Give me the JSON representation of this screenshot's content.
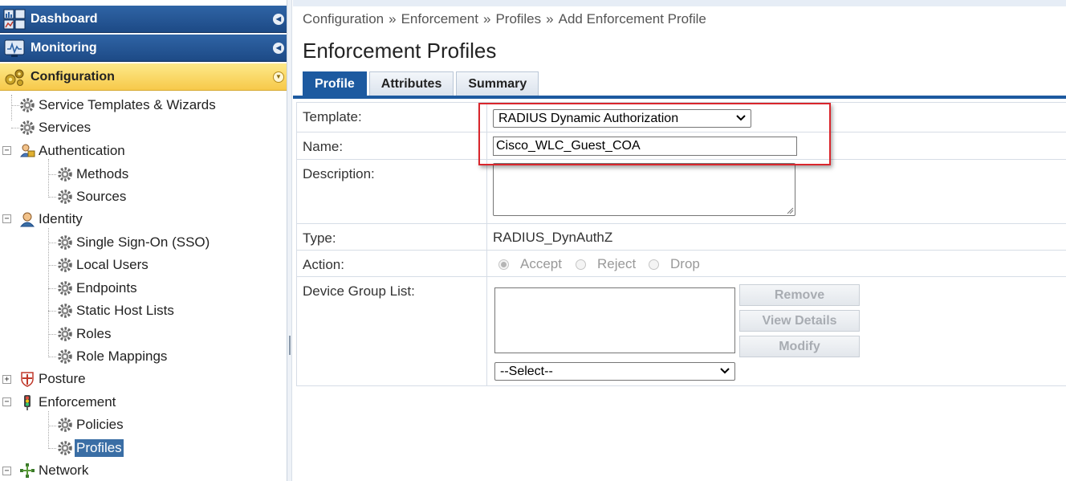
{
  "sidebar": {
    "sections": [
      {
        "label": "Dashboard",
        "icon": "dashboard-icon",
        "state": "collapsed"
      },
      {
        "label": "Monitoring",
        "icon": "monitoring-icon",
        "state": "collapsed"
      },
      {
        "label": "Configuration",
        "icon": "configuration-icon",
        "state": "expanded"
      }
    ],
    "tree": [
      {
        "label": "Service Templates & Wizards",
        "icon": "gear-icon"
      },
      {
        "label": "Services",
        "icon": "gear-icon"
      },
      {
        "label": "Authentication",
        "icon": "authentication-icon",
        "expander": "−"
      },
      {
        "label": "Methods",
        "icon": "gear-icon"
      },
      {
        "label": "Sources",
        "icon": "gear-icon"
      },
      {
        "label": "Identity",
        "icon": "identity-icon",
        "expander": "−"
      },
      {
        "label": "Single Sign-On (SSO)",
        "icon": "gear-icon"
      },
      {
        "label": "Local Users",
        "icon": "gear-icon"
      },
      {
        "label": "Endpoints",
        "icon": "gear-icon"
      },
      {
        "label": "Static Host Lists",
        "icon": "gear-icon"
      },
      {
        "label": "Roles",
        "icon": "gear-icon"
      },
      {
        "label": "Role Mappings",
        "icon": "gear-icon"
      },
      {
        "label": "Posture",
        "icon": "posture-icon",
        "expander": "+"
      },
      {
        "label": "Enforcement",
        "icon": "enforcement-icon",
        "expander": "−"
      },
      {
        "label": "Policies",
        "icon": "gear-icon"
      },
      {
        "label": "Profiles",
        "icon": "gear-icon",
        "selected": true
      },
      {
        "label": "Network",
        "icon": "network-icon",
        "expander": "−"
      }
    ]
  },
  "breadcrumb": [
    "Configuration",
    "Enforcement",
    "Profiles",
    "Add Enforcement Profile"
  ],
  "breadcrumb_separator": "»",
  "page_title": "Enforcement Profiles",
  "tabs": [
    {
      "label": "Profile",
      "active": true
    },
    {
      "label": "Attributes",
      "active": false
    },
    {
      "label": "Summary",
      "active": false
    }
  ],
  "form": {
    "template": {
      "label": "Template:",
      "value": "RADIUS Dynamic Authorization"
    },
    "name": {
      "label": "Name:",
      "value": "Cisco_WLC_Guest_COA"
    },
    "description": {
      "label": "Description:",
      "value": ""
    },
    "type": {
      "label": "Type:",
      "value": "RADIUS_DynAuthZ"
    },
    "action": {
      "label": "Action:",
      "options": [
        "Accept",
        "Reject",
        "Drop"
      ],
      "selected": "Accept",
      "disabled": true
    },
    "device_group_list": {
      "label": "Device Group List:",
      "items": [],
      "select_value": "--Select--",
      "buttons": [
        "Remove",
        "View Details",
        "Modify"
      ]
    }
  },
  "colors": {
    "nav_blue": "#1d4a86",
    "nav_active": "#f7c94a",
    "tab_active": "#1d5aa0",
    "highlight": "#d9262c",
    "selected_tree": "#3a6ea5"
  }
}
